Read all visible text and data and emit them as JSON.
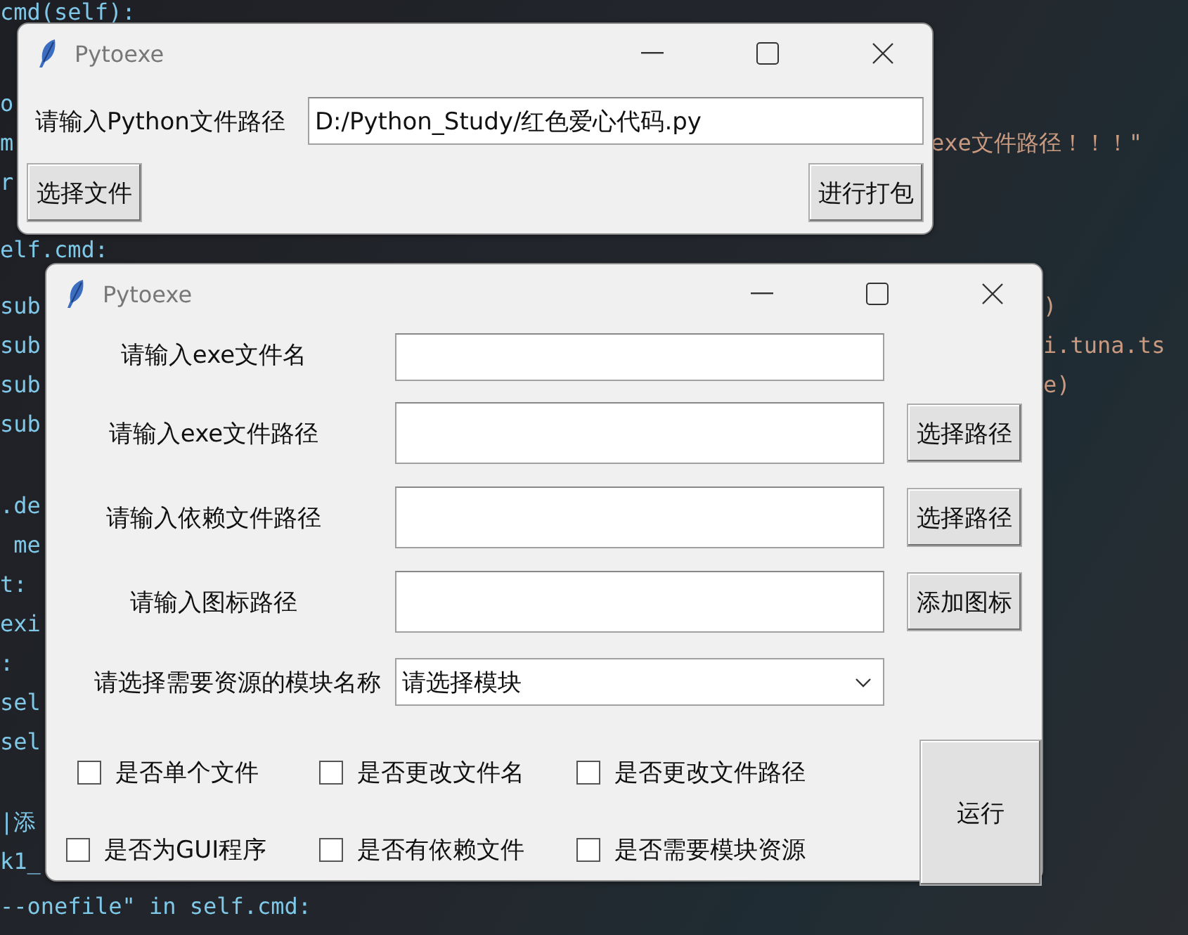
{
  "editor": {
    "blocks": [
      {
        "lines": [
          {
            "left": "cmd(self):"
          },
          {
            "left": "o"
          },
          {
            "left": "m",
            "right": "exe文件路径！！！\""
          },
          {
            "left": "r"
          }
        ]
      },
      {
        "lines": [
          {
            "left": "elf.cmd:"
          },
          {
            "left": "sub",
            "right": ")"
          },
          {
            "left": "sub",
            "right": "i.tuna.ts"
          },
          {
            "left": "sub",
            "right": "e)"
          },
          {
            "left": "sub"
          }
        ]
      },
      {
        "lines": [
          {
            "left": ".de"
          },
          {
            "left": " me"
          },
          {
            "left": "t:"
          },
          {
            "left": "exi"
          },
          {
            "left": ":"
          },
          {
            "left": "sel"
          },
          {
            "left": "sel"
          }
        ]
      },
      {
        "lines": [
          {
            "left": "|添"
          },
          {
            "left": "k1_"
          },
          {
            "left": "--onefile\" in self.cmd:"
          }
        ]
      }
    ]
  },
  "windows": [
    {
      "title": "Pytoexe",
      "kind": "main",
      "label": "请输入Python文件路径",
      "path_value": "D:/Python_Study/红色爱心代码.py",
      "buttons": [
        "选择文件",
        "进行打包"
      ]
    },
    {
      "title": "Pytoexe",
      "kind": "options",
      "rows": [
        {
          "label": "请输入exe文件名"
        },
        {
          "label": "请输入exe文件路径",
          "button": "选择路径"
        },
        {
          "label": "请输入依赖文件路径",
          "button": "选择路径"
        },
        {
          "label": "请输入图标路径",
          "button": "添加图标"
        }
      ],
      "module": {
        "label": "请选择需要资源的模块名称",
        "value": "请选择模块"
      },
      "checkboxes": [
        {
          "label": "是否单个文件",
          "checked": false
        },
        {
          "label": "是否更改文件名",
          "checked": false
        },
        {
          "label": "是否更改文件路径",
          "checked": false
        },
        {
          "label": "是否为GUI程序",
          "checked": false
        },
        {
          "label": "是否有依赖文件",
          "checked": false
        },
        {
          "label": "是否需要模块资源",
          "checked": false
        }
      ],
      "run_button": "运行"
    }
  ]
}
